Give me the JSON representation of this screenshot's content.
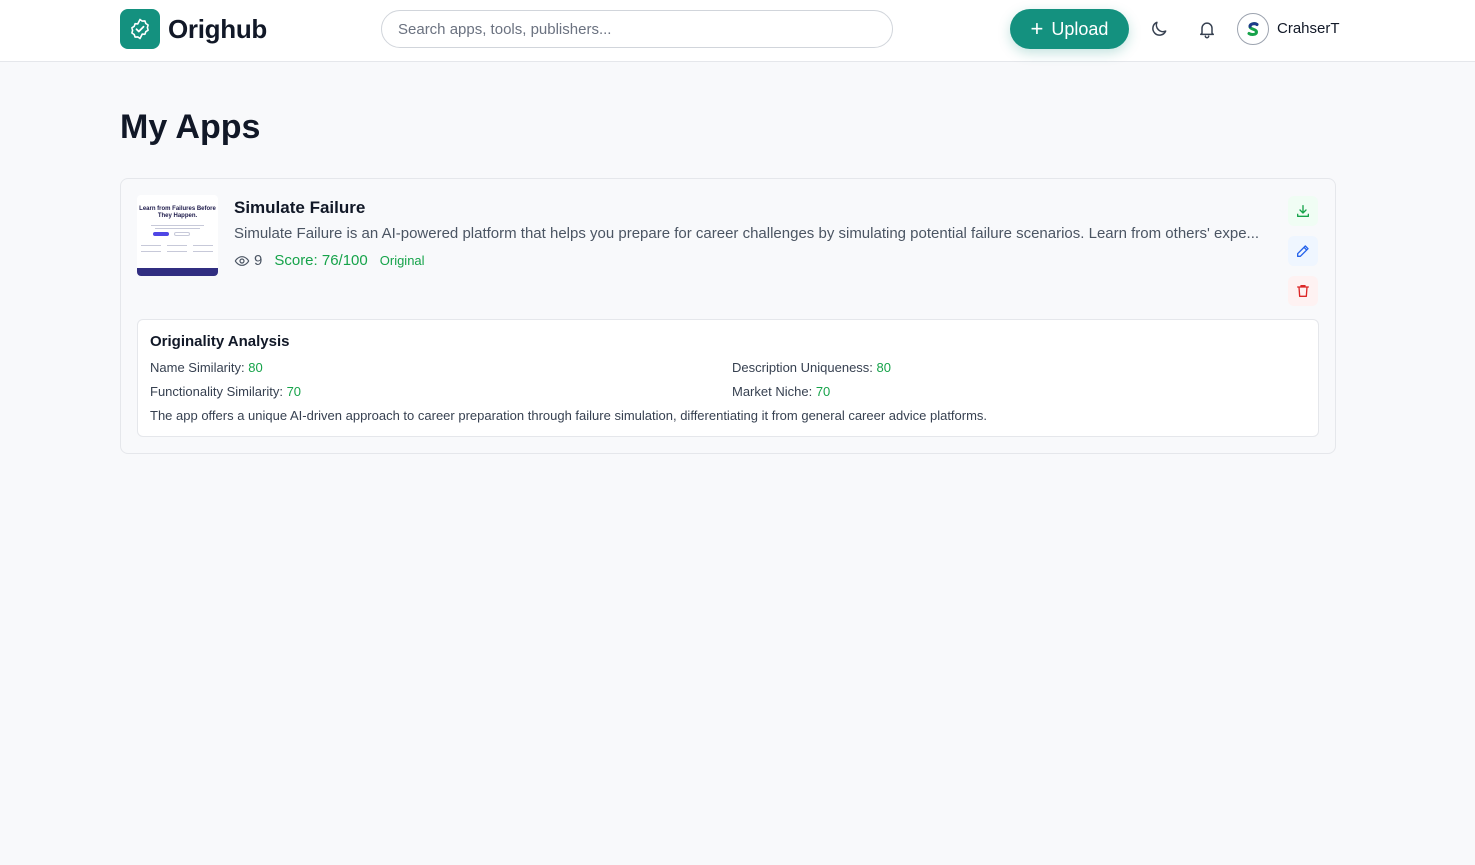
{
  "header": {
    "brand": "Orighub",
    "search_placeholder": "Search apps, tools, publishers...",
    "upload_label": "Upload",
    "username": "CrahserT"
  },
  "main": {
    "title": "My Apps",
    "apps": [
      {
        "thumbnail_text": "Learn from Failures Before They Happen.",
        "name": "Simulate Failure",
        "description": "Simulate Failure is an AI-powered platform that helps you prepare for career challenges by simulating potential failure scenarios. Learn from others' expe...",
        "views": "9",
        "score": "Score: 76/100",
        "badge": "Original",
        "analysis": {
          "title": "Originality Analysis",
          "name_similarity_label": "Name Similarity:",
          "name_similarity": "80",
          "description_uniqueness_label": "Description Uniqueness:",
          "description_uniqueness": "80",
          "functionality_similarity_label": "Functionality Similarity:",
          "functionality_similarity": "70",
          "market_niche_label": "Market Niche:",
          "market_niche": "70",
          "summary": "The app offers a unique AI-driven approach to career preparation through failure simulation, differentiating it from general career advice platforms."
        }
      }
    ]
  },
  "colors": {
    "brand": "#14917f",
    "success": "#16a34a",
    "edit": "#2563eb",
    "danger": "#dc2626"
  },
  "icons": {
    "logo": "check-badge-icon",
    "theme": "moon-icon",
    "notifications": "bell-icon",
    "views": "eye-icon",
    "download": "download-icon",
    "edit": "pencil-icon",
    "delete": "trash-icon"
  }
}
